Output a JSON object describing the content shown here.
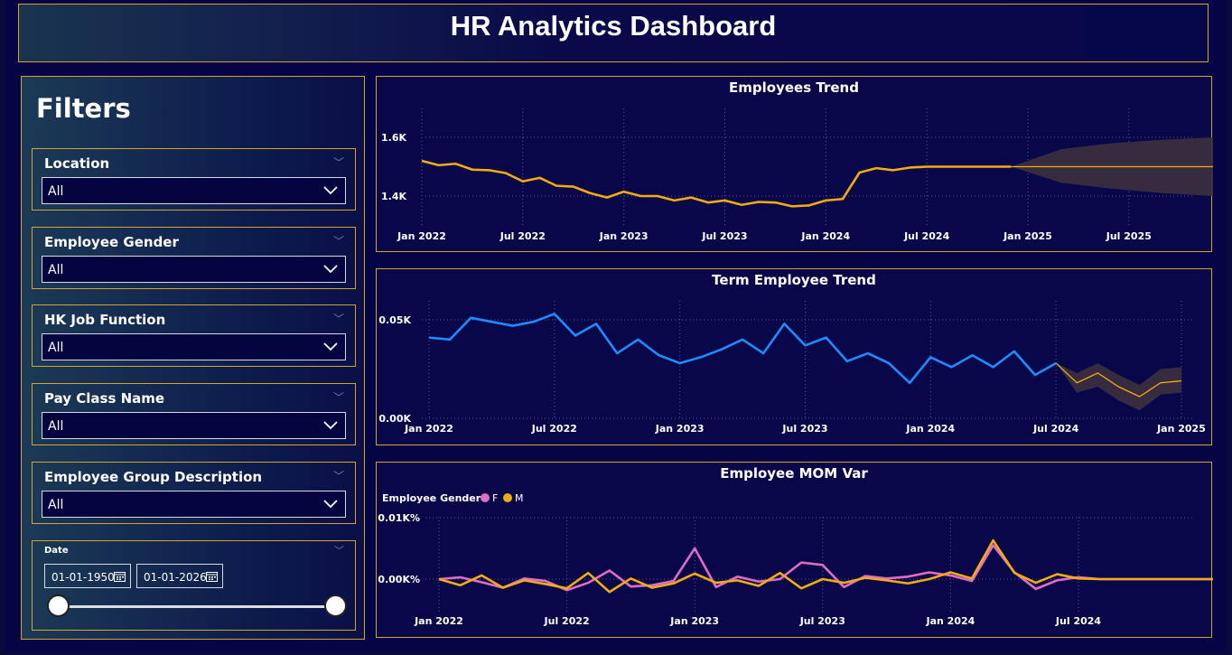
{
  "title": "HR Analytics Dashboard",
  "filters": {
    "heading": "Filters",
    "slicers": [
      {
        "label": "Location",
        "value": "All"
      },
      {
        "label": "Employee Gender",
        "value": "All"
      },
      {
        "label": "HK Job Function",
        "value": "All"
      },
      {
        "label": "Pay Class Name",
        "value": "All"
      },
      {
        "label": "Employee Group Description",
        "value": "All"
      }
    ],
    "date": {
      "label": "Date",
      "start": "01-01-1950",
      "end": "01-01-2026"
    }
  },
  "colors": {
    "accent": "#d4a52a",
    "gold": "#f2ab10",
    "blue": "#1e8cff",
    "pink": "#e06cc4",
    "forecast_band": "#3a2e3e"
  },
  "chart_data": [
    {
      "type": "line",
      "title": "Employees Trend",
      "x_ticks": [
        "Jan 2022",
        "Jul 2022",
        "Jan 2023",
        "Jul 2023",
        "Jan 2024",
        "Jul 2024",
        "Jan 2025",
        "Jul 2025"
      ],
      "y_ticks": [
        "1.4K",
        "1.6K"
      ],
      "ylim": [
        1290,
        1720
      ],
      "start": "2022-01",
      "series": [
        {
          "values": [
            1520,
            1505,
            1510,
            1490,
            1488,
            1478,
            1450,
            1462,
            1435,
            1432,
            1410,
            1395,
            1415,
            1400,
            1400,
            1385,
            1395,
            1378,
            1385,
            1370,
            1380,
            1378,
            1365,
            1368,
            1385,
            1390,
            1480,
            1495,
            1488,
            1497,
            1500,
            1500,
            1500,
            1500,
            1500,
            1500
          ]
        }
      ],
      "forecast": {
        "values": [
          1500,
          1500,
          1500,
          1500,
          1500,
          1500,
          1500,
          1500
        ],
        "upper": [
          1500,
          1560,
          1580,
          1592,
          1600,
          1607,
          1612,
          1615
        ],
        "lower": [
          1500,
          1445,
          1425,
          1410,
          1400,
          1395,
          1388,
          1385
        ]
      }
    },
    {
      "type": "line",
      "title": "Term Employee Trend",
      "x_ticks": [
        "Jan 2022",
        "Jul 2022",
        "Jan 2023",
        "Jul 2023",
        "Jan 2024",
        "Jul 2024",
        "Jan 2025"
      ],
      "y_ticks": [
        "0.00K",
        "0.05K"
      ],
      "ylim": [
        0,
        55
      ],
      "start": "2022-01",
      "series": [
        {
          "values": [
            41,
            40,
            51,
            49,
            47,
            49,
            53,
            42,
            48,
            33,
            40,
            32,
            28,
            31,
            35,
            40,
            33,
            48,
            37,
            41,
            29,
            33,
            28,
            18,
            31,
            26,
            32,
            26,
            34,
            22,
            28
          ]
        }
      ],
      "forecast": {
        "values": [
          28,
          18,
          23,
          16,
          11,
          18,
          19
        ],
        "upper": [
          28,
          23,
          28,
          22,
          17,
          25,
          26
        ],
        "lower": [
          28,
          13,
          16,
          9,
          4,
          12,
          13
        ]
      }
    },
    {
      "type": "line",
      "title": "Employee MOM Var",
      "legend_title": "Employee Gender",
      "x_ticks": [
        "Jan 2022",
        "Jul 2022",
        "Jan 2023",
        "Jul 2023",
        "Jan 2024",
        "Jul 2024"
      ],
      "y_ticks": [
        "0.00K%",
        "0.01K%"
      ],
      "ylim": [
        -5,
        10
      ],
      "start": "2022-01",
      "series": [
        {
          "name": "F",
          "color": "#e06cc4",
          "values": [
            0,
            0.3,
            -0.5,
            -1.4,
            0.1,
            -0.3,
            -1.8,
            -0.6,
            1.4,
            -1.2,
            -1.0,
            -0.3,
            5.0,
            -1.3,
            0.4,
            -0.4,
            0.0,
            2.7,
            2.3,
            -1.3,
            0.5,
            0.1,
            0.4,
            1.1,
            0.6,
            -0.3,
            5.5,
            1.1,
            -1.6,
            -0.2,
            0.3,
            0,
            0,
            0,
            0,
            0,
            0,
            0,
            0,
            0
          ]
        },
        {
          "name": "M",
          "color": "#f2ab10",
          "values": [
            0,
            -1.0,
            0.6,
            -1.4,
            -0.2,
            -0.8,
            -1.5,
            1.0,
            -2.1,
            0.1,
            -1.4,
            -0.7,
            0.9,
            -0.6,
            -0.2,
            -1.1,
            1.0,
            -1.5,
            0.0,
            -0.6,
            0.2,
            -0.2,
            -0.7,
            0.0,
            1.1,
            0.1,
            6.3,
            1.0,
            -0.6,
            0.8,
            0.1,
            0,
            0,
            0,
            0,
            0,
            0,
            0,
            0,
            0
          ]
        }
      ]
    }
  ]
}
